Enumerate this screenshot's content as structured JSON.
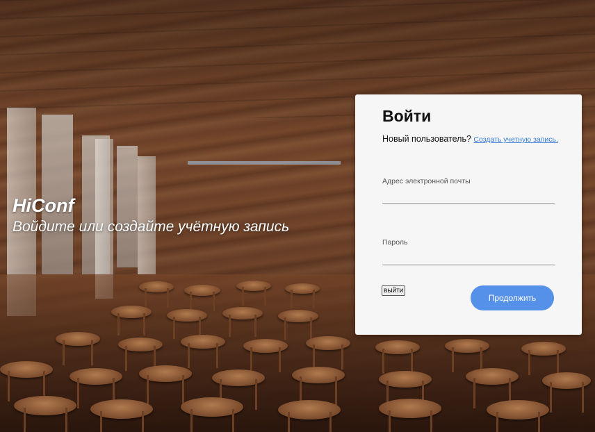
{
  "hero": {
    "title": "HiConf",
    "subtitle": "Войдите или создайте учётную запись"
  },
  "login": {
    "title": "Войти",
    "new_user_text": "Новый пользователь?",
    "signup_link": "Создать учетную запись.",
    "email_label": "Адрес электронной почты",
    "email_value": "",
    "password_label": "Пароль",
    "password_value": "",
    "logout_label": "выйти",
    "continue_label": "Продолжить"
  },
  "colors": {
    "accent": "#5591e8",
    "link": "#3b7bd6",
    "card_bg": "#f6f6f6"
  }
}
